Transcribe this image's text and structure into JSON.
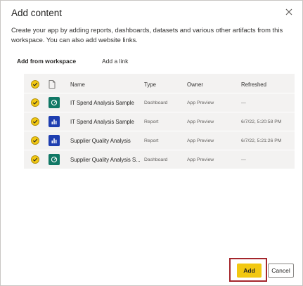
{
  "dialog": {
    "title": "Add content",
    "description": "Create your app by adding reports, dashboards, datasets and various other artifacts from this workspace. You can also add website links."
  },
  "tabs": [
    {
      "label": "Add from workspace",
      "active": true
    },
    {
      "label": "Add a link",
      "active": false
    }
  ],
  "table": {
    "columns": {
      "name": "Name",
      "type": "Type",
      "owner": "Owner",
      "refreshed": "Refreshed"
    },
    "rows": [
      {
        "selected": true,
        "icon": "dashboard-icon",
        "name": "IT Spend Analysis Sample",
        "type": "Dashboard",
        "owner": "App Preview",
        "refreshed": "—"
      },
      {
        "selected": true,
        "icon": "report-icon",
        "name": "IT Spend Analysis Sample",
        "type": "Report",
        "owner": "App Preview",
        "refreshed": "6/7/22, 5:20:58 PM"
      },
      {
        "selected": true,
        "icon": "report-icon",
        "name": "Supplier Quality Analysis",
        "type": "Report",
        "owner": "App Preview",
        "refreshed": "6/7/22, 5:21:26 PM"
      },
      {
        "selected": true,
        "icon": "dashboard-icon",
        "name": "Supplier Quality Analysis S...",
        "type": "Dashboard",
        "owner": "App Preview",
        "refreshed": "—"
      }
    ]
  },
  "buttons": {
    "add": "Add",
    "cancel": "Cancel"
  },
  "colors": {
    "accent": "#f2c811",
    "dashboard": "#117865",
    "report": "#1e3eb0",
    "highlight": "#a4262c"
  }
}
